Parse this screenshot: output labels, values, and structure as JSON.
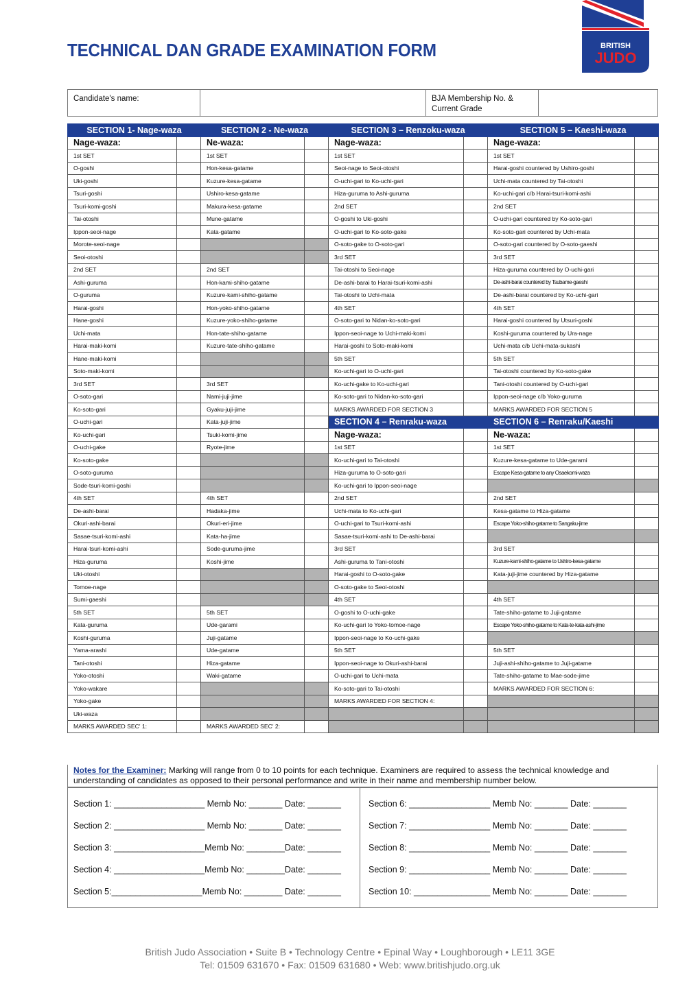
{
  "header": {
    "title": "TECHNICAL DAN GRADE EXAMINATION FORM",
    "logo": {
      "line1": "BRITISH",
      "line2": "JUDO",
      "colors": {
        "blue": "#1f3f95",
        "red": "#e3232b"
      }
    }
  },
  "candidate": {
    "name_label": "Candidate's name:",
    "name_value": "",
    "membership_label": "BJA Membership No. & Current Grade",
    "membership_value": ""
  },
  "sections_top": [
    "SECTION 1- Nage-waza",
    "SECTION 2 - Ne-waza",
    "SECTION 3 – Renzoku-waza",
    "SECTION 5 – Kaeshi-waza"
  ],
  "subheaders_top": [
    "Nage-waza:",
    "Ne-waza:",
    "Nage-waza:",
    "Nage-waza:"
  ],
  "section1": [
    "1st SET",
    "O-goshi",
    "Uki-goshi",
    "Tsuri-goshi",
    "Tsuri-komi-goshi",
    "Tai-otoshi",
    "Ippon-seoi-nage",
    "Morote-seoi-nage",
    "Seoi-otoshi",
    "2nd SET",
    "Ashi-guruma",
    "O-guruma",
    "Harai-goshi",
    "Hane-goshi",
    "Uchi-mata",
    "Harai-maki-komi",
    "Hane-maki-komi",
    "Soto-maki-komi",
    "3rd SET",
    "O-soto-gari",
    "Ko-soto-gari",
    "O-uchi-gari",
    "Ko-uchi-gari",
    "O-uchi-gake",
    "Ko-soto-gake",
    "O-soto-guruma",
    "Sode-tsuri-komi-goshi",
    "4th SET",
    "De-ashi-barai",
    "Okuri-ashi-barai",
    "Sasae-tsuri-komi-ashi",
    "Harai-tsuri-komi-ashi",
    "Hiza-guruma",
    "Uki-otoshi",
    "Tomoe-nage",
    "Sumi-gaeshi",
    "5th SET",
    "Kata-guruma",
    "Koshi-guruma",
    "Yama-arashi",
    "Tani-otoshi",
    "Yoko-otoshi",
    "Yoko-wakare",
    "Yoko-gake",
    "Uki-waza",
    "MARKS AWARDED SEC' 1:"
  ],
  "section2": [
    "1st SET",
    "Hon-kesa-gatame",
    "Kuzure-kesa-gatame",
    "Ushiro-kesa-gatame",
    "Makura-kesa-gatame",
    "Mune-gatame",
    "Kata-gatame",
    null,
    null,
    "2nd SET",
    "Hon-kami-shiho-gatame",
    "Kuzure-kami-shiho-gatame",
    "Hon-yoko-shiho-gatame",
    "Kuzure-yoko-shiho-gatame",
    "Hon-tate-shiho-gatame",
    "Kuzure-tate-shiho-gatame",
    null,
    null,
    "3rd SET",
    "Nami-juji-jime",
    "Gyaku-juji-jime",
    "Kata-juji-jime",
    "Tsuki-komi-jime",
    "Ryote-jime",
    null,
    null,
    null,
    "4th SET",
    "Hadaka-jime",
    "Okuri-eri-jime",
    "Kata-ha-jime",
    "Sode-guruma-jime",
    "Koshi-jime",
    null,
    null,
    null,
    "5th SET",
    "Ude-garami",
    "Juji-gatame",
    "Ude-gatame",
    "Hiza-gatame",
    "Waki-gatame",
    null,
    null,
    null,
    "MARKS AWARDED SEC' 2:"
  ],
  "section3": [
    "1st SET",
    "Seoi-nage to Seoi-otoshi",
    "O-uchi-gari to Ko-uchi-gari",
    "Hiza-guruma to Ashi-guruma",
    "2nd SET",
    "O-goshi to Uki-goshi",
    "O-uchi-gari to Ko-soto-gake",
    "O-soto-gake to O-soto-gari",
    "3rd SET",
    "Tai-otoshi to Seoi-nage",
    "De-ashi-barai to Harai-tsuri-komi-ashi",
    "Tai-otoshi to Uchi-mata",
    "4th SET",
    "O-soto-gari to Nidan-ko-soto-gari",
    "Ippon-seoi-nage to Uchi-maki-komi",
    "Harai-goshi to Soto-maki-komi",
    "5th SET",
    "Ko-uchi-gari to O-uchi-gari",
    "Ko-uchi-gake to Ko-uchi-gari",
    "Ko-soto-gari to Nidan-ko-soto-gari",
    "MARKS AWARDED FOR SECTION 3"
  ],
  "section5": [
    "1st SET",
    "Harai-goshi countered by Ushiro-goshi",
    "Uchi-mata countered by Tai-otoshi",
    "Ko-uchi-gari c/b Harai-tsuri-komi-ashi",
    "2nd SET",
    "O-uchi-gari countered by Ko-soto-gari",
    "Ko-soto-gari countered by Uchi-mata",
    "O-soto-gari countered by O-soto-gaeshi",
    "3rd SET",
    "Hiza-guruma countered by O-uchi-gari",
    "De-ashi-barai countered by Tsubame-gaeshi",
    "De-ashi-barai countered by Ko-uchi-gari",
    "4th SET",
    "Harai-goshi countered by Utsuri-goshi",
    "Koshi-guruma countered by Ura-nage",
    "Uchi-mata c/b Uchi-mata-sukashi",
    "5th SET",
    "Tai-otoshi countered by Ko-soto-gake",
    "Tani-otoshi countered by O-uchi-gari",
    "Ippon-seoi-nage c/b Yoko-guruma",
    "MARKS AWARDED FOR SECTION 5"
  ],
  "sections_mid": [
    "SECTION 4 – Renraku-waza",
    "SECTION 6 – Renraku/Kaeshi"
  ],
  "subheaders_mid": [
    "Nage-waza:",
    "Ne-waza:"
  ],
  "section4": [
    "1st SET",
    "Ko-uchi-gari to Tai-otoshi",
    "Hiza-guruma to O-soto-gari",
    "Ko-uchi-gari to Ippon-seoi-nage",
    "2nd SET",
    "Uchi-mata to Ko-uchi-gari",
    "O-uchi-gari to Tsuri-komi-ashi",
    "Sasae-tsuri-komi-ashi to De-ashi-barai",
    "3rd SET",
    "Ashi-guruma to Tani-otoshi",
    "Harai-goshi to O-soto-gake",
    "O-soto-gake to Seoi-otoshi",
    "4th SET",
    "O-goshi to O-uchi-gake",
    "Ko-uchi-gari to Yoko-tomoe-nage",
    "Ippon-seoi-nage to Ko-uchi-gake",
    "5th SET",
    "Ippon-seoi-nage to Okuri-ashi-barai",
    "O-uchi-gari to Uchi-mata",
    "Ko-soto-gari to Tai-otoshi",
    "MARKS AWARDED FOR SECTION 4:",
    null,
    null
  ],
  "section6": [
    "1st SET",
    "Kuzure-kesa-gatame to Ude-garami",
    "Escape Kesa-gatame to any Osaekomi-waza",
    null,
    "2nd SET",
    "Kesa-gatame to Hiza-gatame",
    "Escape Yoko-shiho-gatame to Sangaku-jime",
    null,
    "3rd SET",
    "Kuzure-kami-shiho-gatame to Ushiro-kesa-gatame",
    "Kata-juji-jime countered by Hiza-gatame",
    null,
    "4th SET",
    "Tate-shiho-gatame to Juji-gatame",
    "Escape Yoko-shiho-gatame to Kata-te-kata-ashi-jime",
    null,
    "5th SET",
    "Juji-ashi-shiho-gatame to Juji-gatame",
    "Tate-shiho-gatame to Mae-sode-jime",
    "MARKS AWARDED FOR SECTION 6:",
    null,
    null,
    null
  ],
  "notes": {
    "label": "Notes for the Examiner:",
    "text": " Marking  will range from 0 to 10 points for each technique. Examiners are required to assess the technical knowledge and understanding of candidates as opposed to their personal performance and write in their name and membership number below."
  },
  "signatures_left": [
    "Section 1: ___________________ Memb No: _______ Date: _______",
    "Section 2: ___________________ Memb No: _______ Date: _______",
    "Section 3: ___________________Memb No: ________Date: _______",
    "Section 4: ___________________Memb No: ________Date: _______",
    "Section 5:___________________Memb No: ________ Date: _______"
  ],
  "signatures_right": [
    "Section 6: _________________ Memb No: _______ Date: _______",
    "Section 7: _________________ Memb No: _______ Date: _______",
    "Section 8: _________________ Memb No: _______ Date: _______",
    "Section 9: _________________ Memb No: _______ Date: _______",
    "Section 10: ________________ Memb No: _______ Date: _______"
  ],
  "footer": {
    "line1": "British Judo Association • Suite B • Technology Centre • Epinal Way • Loughborough • LE11 3GE",
    "line2": "Tel: 01509 631670 • Fax: 01509 631680 • Web: www.britishjudo.org.uk"
  }
}
